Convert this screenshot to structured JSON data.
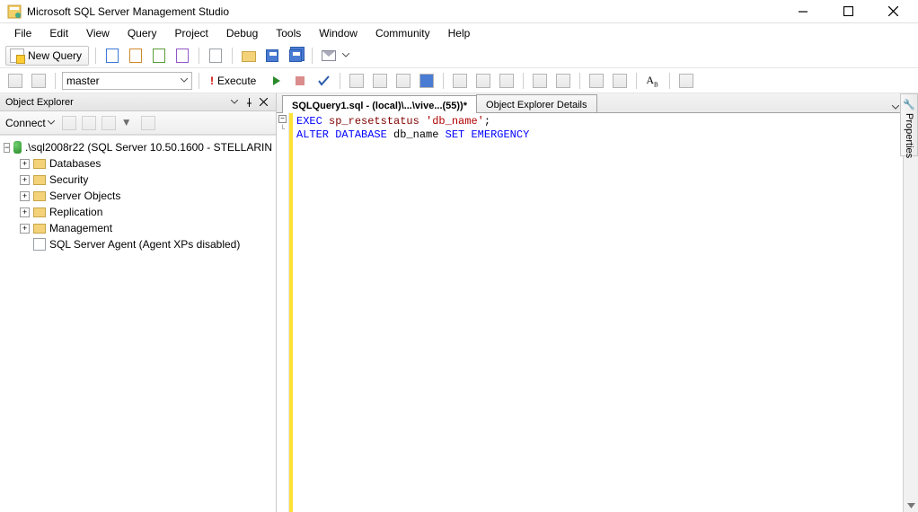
{
  "title": "Microsoft SQL Server Management Studio",
  "menu": [
    "File",
    "Edit",
    "View",
    "Query",
    "Project",
    "Debug",
    "Tools",
    "Window",
    "Community",
    "Help"
  ],
  "toolbar": {
    "new_query": "New Query",
    "database": "master",
    "execute": "Execute"
  },
  "object_explorer": {
    "title": "Object Explorer",
    "connect": "Connect",
    "server": ".\\sql2008r22 (SQL Server 10.50.1600 - STELLARIN",
    "nodes": [
      "Databases",
      "Security",
      "Server Objects",
      "Replication",
      "Management",
      "SQL Server Agent (Agent XPs disabled)"
    ]
  },
  "tabs": {
    "active": "SQLQuery1.sql - (local)\\...\\vive...(55))*",
    "other": "Object Explorer Details"
  },
  "code": {
    "l1": {
      "a": "EXEC",
      "b": " sp_resetstatus ",
      "c": "'db_name'",
      "d": ";"
    },
    "l2": {
      "a": "ALTER",
      "b": " DATABASE ",
      "c": "db_name",
      "d": " SET ",
      "e": "EMERGENCY"
    }
  },
  "properties_label": "Properties"
}
